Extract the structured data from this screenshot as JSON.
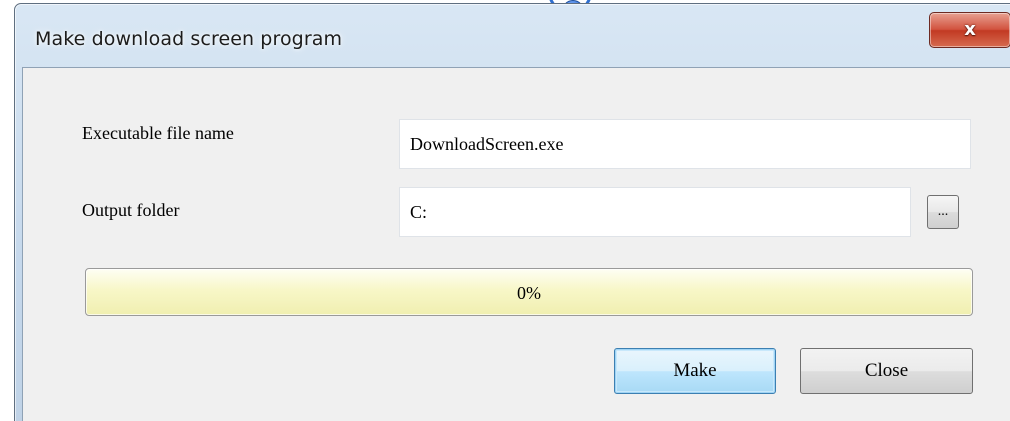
{
  "window": {
    "title": "Make download screen program",
    "close_glyph": "x"
  },
  "form": {
    "exe_label": "Executable file name",
    "exe_value": "DownloadScreen.exe",
    "output_label": "Output folder",
    "output_value": "C:",
    "browse_label": "..."
  },
  "progress": {
    "value": 0,
    "text": "0%"
  },
  "buttons": {
    "make_label": "Make",
    "close_label": "Close"
  },
  "colors": {
    "titlebar": "#c5d8ec",
    "close_button": "#c23a23",
    "progress_bar": "#f8f7c8",
    "make_button_focus": "#3c7fb1"
  }
}
